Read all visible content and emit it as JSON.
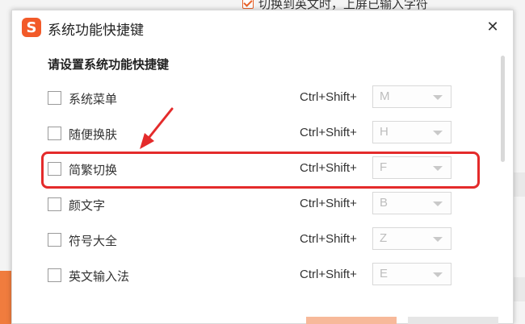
{
  "background": {
    "top_option_label": "切换到英文时，上屏已输入字符"
  },
  "dialog": {
    "logo_glyph": "S",
    "title": "系统功能快捷键",
    "close_glyph": "✕",
    "section_heading": "请设置系统功能快捷键",
    "rows": [
      {
        "label": "系统菜单",
        "modifier": "Ctrl+Shift+",
        "key": "M",
        "checked": false
      },
      {
        "label": "随便换肤",
        "modifier": "Ctrl+Shift+",
        "key": "H",
        "checked": false
      },
      {
        "label": "简繁切换",
        "modifier": "Ctrl+Shift+",
        "key": "F",
        "checked": false,
        "highlighted": true
      },
      {
        "label": "颜文字",
        "modifier": "Ctrl+Shift+",
        "key": "B",
        "checked": false
      },
      {
        "label": "符号大全",
        "modifier": "Ctrl+Shift+",
        "key": "Z",
        "checked": false
      },
      {
        "label": "英文输入法",
        "modifier": "Ctrl+Shift+",
        "key": "E",
        "checked": false
      }
    ]
  },
  "colors": {
    "brand": "#f25a29",
    "highlight": "#e42b2b",
    "primary_button": "#f7b99a",
    "secondary_button": "#e6e6e6"
  },
  "icons": {
    "logo": "sogou-s-logo-icon",
    "close": "close-icon",
    "dropdown": "chevron-down-icon",
    "annotation": "red-arrow-annotation"
  }
}
